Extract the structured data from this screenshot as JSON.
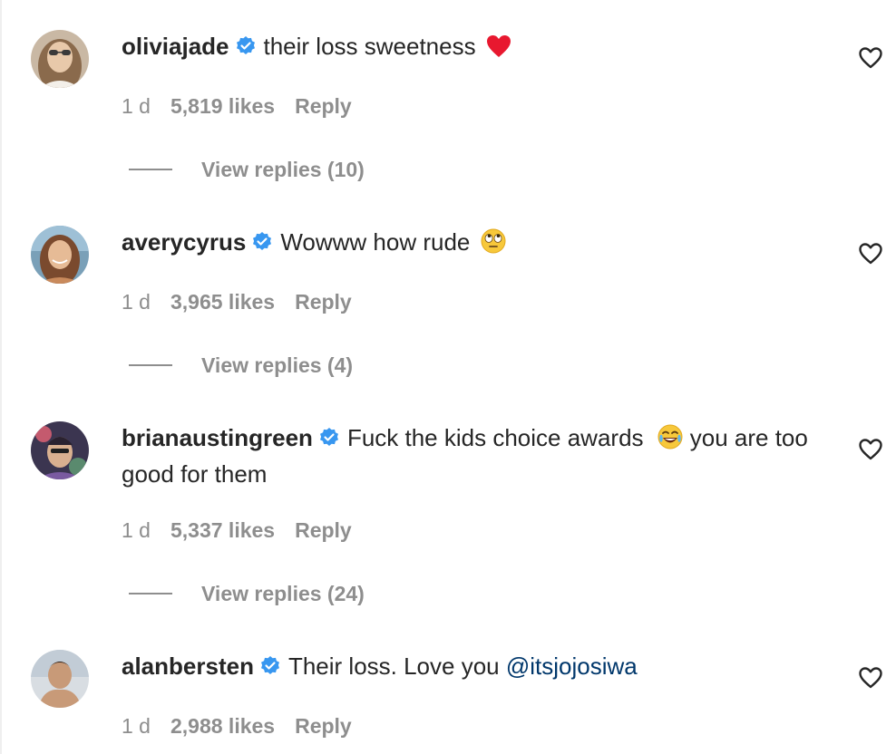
{
  "comments": [
    {
      "username": "oliviajade",
      "text": "their loss sweetness",
      "emoji": "red-heart",
      "time": "1 d",
      "likes": "5,819 likes",
      "reply": "Reply",
      "view_replies": "View replies (10)"
    },
    {
      "username": "averycyrus",
      "text": "Wowww how rude",
      "emoji": "face-with-rolling-eyes",
      "time": "1 d",
      "likes": "3,965 likes",
      "reply": "Reply",
      "view_replies": "View replies (4)"
    },
    {
      "username": "brianaustingreen",
      "text": "Fuck the kids choice awards",
      "emoji": "face-with-tears-of-joy",
      "text_after": "you are too good for them",
      "time": "1 d",
      "likes": "5,337 likes",
      "reply": "Reply",
      "view_replies": "View replies (24)"
    },
    {
      "username": "alanbersten",
      "text": "Their loss. Love you",
      "mention": "@itsjojosiwa",
      "time": "1 d",
      "likes": "2,988 likes",
      "reply": "Reply"
    }
  ],
  "colors": {
    "text": "#262626",
    "secondary": "#8e8e8e",
    "verified": "#3897f0",
    "mention": "#00376b"
  },
  "icons": [
    "verified-badge-icon",
    "heart-outline-icon",
    "red-heart-emoji",
    "rolling-eyes-emoji",
    "tears-of-joy-emoji"
  ]
}
